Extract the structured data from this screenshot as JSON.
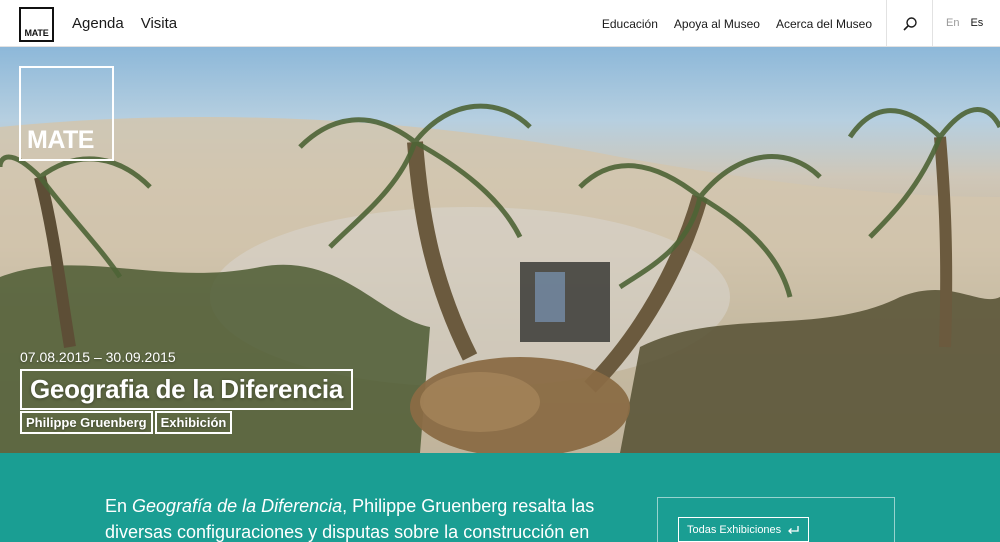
{
  "header": {
    "logo_text": "MATE",
    "main_nav": [
      "Agenda",
      "Visita"
    ],
    "sub_nav": [
      "Educación",
      "Apoya al Museo",
      "Acerca del Museo"
    ],
    "search_icon": "search-icon",
    "languages": {
      "en": "En",
      "es": "Es",
      "active": "Es"
    }
  },
  "hero": {
    "logo_text": "MATE",
    "dates": "07.08.2015 – 30.09.2015",
    "title": "Geografia de la Diferencia",
    "artist": "Philippe Gruenberg",
    "category": "Exhibición"
  },
  "info": {
    "intro_prefix": "En ",
    "intro_italic": "Geografía de la Diferencia",
    "intro_line1_rest": ", Philippe Gruenberg resalta las",
    "intro_line2": "diversas configuraciones y disputas sobre la construcción en",
    "all_exhibitions_label": "Todas Exhibiciones",
    "all_exhibitions_icon": "return-arrow-icon"
  },
  "colors": {
    "teal": "#1a9e93",
    "header_border": "#e2e2e2"
  }
}
